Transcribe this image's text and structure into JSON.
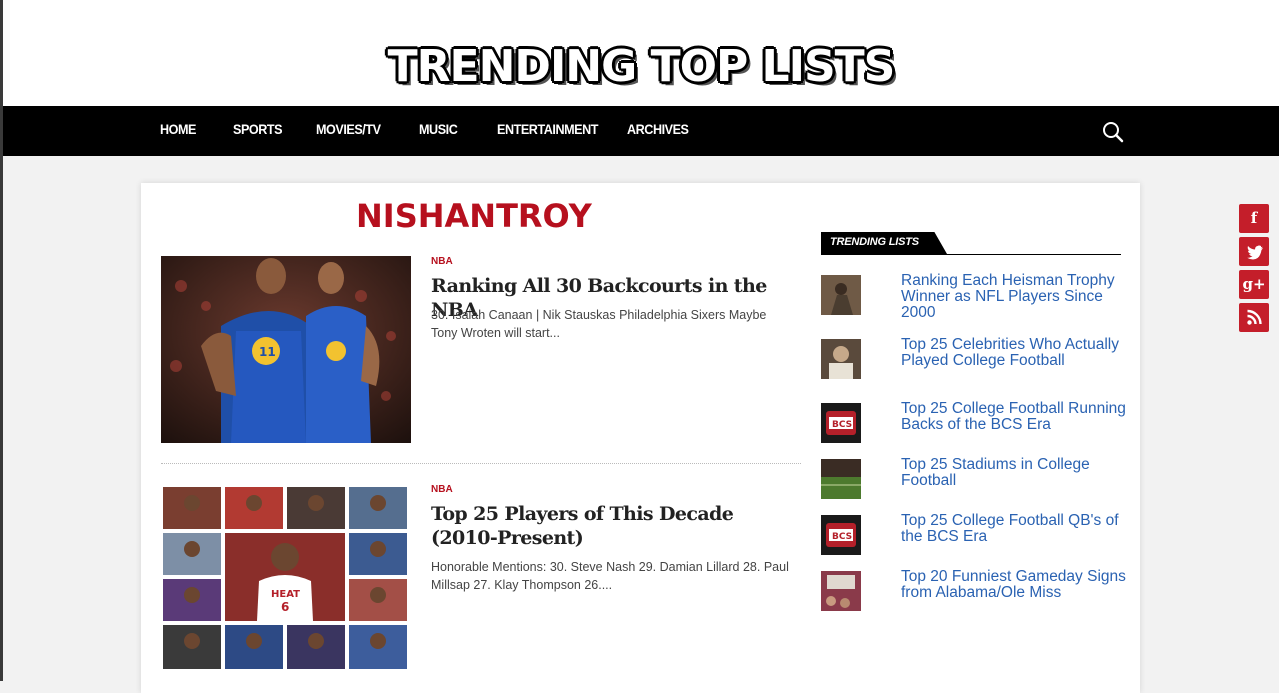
{
  "site": {
    "logo": "TRENDING TOP LISTS"
  },
  "nav": {
    "items": [
      "HOME",
      "SPORTS",
      "MOVIES/TV",
      "MUSIC",
      "ENTERTAINMENT",
      "ARCHIVES"
    ],
    "search_icon": "search-icon"
  },
  "author": {
    "name": "NISHANTROY"
  },
  "posts": [
    {
      "category": "NBA",
      "title": "Ranking All 30 Backcourts in the NBA",
      "excerpt": "30. Isaiah Canaan | Nik Stauskas Philadelphia Sixers Maybe Tony Wroten will start..."
    },
    {
      "category": "NBA",
      "title": "Top 25 Players of This Decade (2010-Present)",
      "excerpt": "Honorable Mentions: 30. Steve Nash 29. Damian Lillard 28. Paul Millsap 27. Klay Thompson 26...."
    }
  ],
  "sidebar": {
    "widget_title": "TRENDING LISTS",
    "items": [
      {
        "title": "Ranking Each Heisman Trophy Winner as NFL Players Since 2000"
      },
      {
        "title": "Top 25 Celebrities Who Actually Played College Football"
      },
      {
        "title": "Top 25 College Football Running Backs of the BCS Era"
      },
      {
        "title": "Top 25 Stadiums in College Football"
      },
      {
        "title": "Top 25 College Football QB's of the BCS Era"
      },
      {
        "title": "Top 20 Funniest Gameday Signs from Alabama/Ole Miss"
      }
    ]
  },
  "share": {
    "buttons": [
      {
        "icon": "facebook-icon",
        "glyph": "f"
      },
      {
        "icon": "twitter-icon",
        "glyph": ""
      },
      {
        "icon": "google-plus-icon",
        "glyph": "g+"
      },
      {
        "icon": "rss-icon",
        "glyph": ""
      }
    ],
    "color": "#c41e2a"
  },
  "colors": {
    "accent": "#b6101e",
    "link": "#2a62b2",
    "nav_bg": "#000000"
  }
}
